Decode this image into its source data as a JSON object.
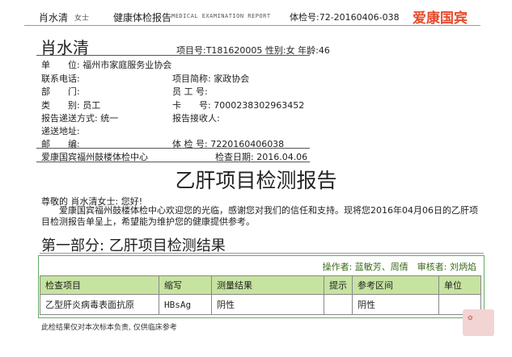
{
  "header": {
    "name": "肖水清",
    "sub": "女士",
    "title": "健康体检报告",
    "title_en": "MEDICAL EXAMINATION REPORT",
    "exam_no": "体检号:72-20160406-038",
    "brand": "爱康国宾"
  },
  "patient": {
    "name": "肖水清",
    "item_line": "项目号:T181620005  性别:女  年龄:46"
  },
  "fields": {
    "unit_label": "单　　位:",
    "unit_value": "福州市家庭服务业协会",
    "phone_label": "联系电话:",
    "dept_label": "部　　门:",
    "type_label": "类　　别:",
    "type_value": "员工",
    "deliver_label": "报告递送方式:",
    "deliver_value": "统一",
    "addr_label": "递送地址:",
    "zip_label": "邮　　编:",
    "proj_label": "项目简称:",
    "proj_value": "家政协会",
    "emp_label": "员 工 号:",
    "card_label": "卡　　号:",
    "card_value": "7000238302963452",
    "recv_label": "报告接收人:",
    "exam_label": "体 检 号:",
    "exam_value": "7220160406038",
    "center": "爱康国宾福州鼓楼体检中心",
    "date": "检查日期: 2016.04.06"
  },
  "report": {
    "title": "乙肝项目检测报告",
    "greeting": "尊敬的 肖水清女士: 您好!",
    "paragraph": "爱康国宾福州鼓楼体检中心欢迎您的光临，感谢您对我们的信任和支持。现将您2016年04月06日的乙肝项目检测报告单呈上，希望能为维护您的健康提供参考。",
    "section": "第一部分: 乙肝项目检测结果",
    "operator": "操作者: 蓝敏芳、周倩　审核者: 刘炳焰",
    "columns": [
      "检查项目",
      "缩写",
      "测量结果",
      "提示",
      "参考区间",
      "单位"
    ],
    "rows": [
      [
        "乙型肝炎病毒表面抗原",
        "HBsAg",
        "阴性",
        "",
        "阴性",
        ""
      ]
    ],
    "footnote": "此检结果仅对本次标本负责, 仅供临床参考"
  }
}
